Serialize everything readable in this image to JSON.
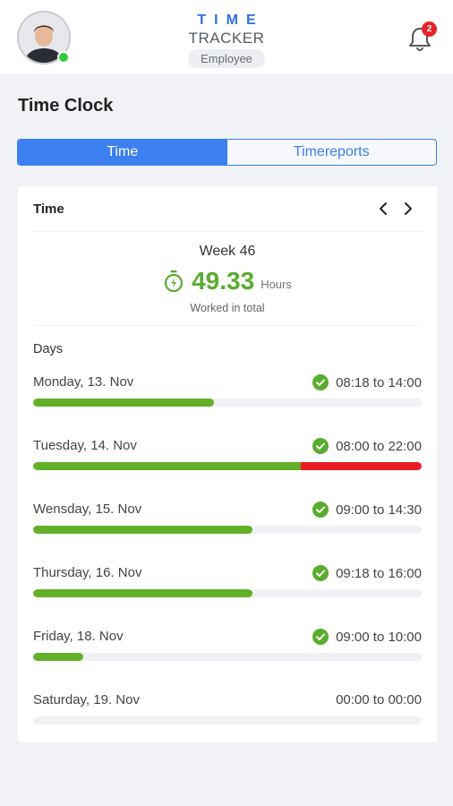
{
  "header": {
    "logo_line1": "TIME",
    "logo_line2": "TRACKER",
    "role": "Employee",
    "notification_count": "2",
    "user_status": "online"
  },
  "page": {
    "title": "Time Clock"
  },
  "tabs": [
    {
      "label": "Time",
      "active": true
    },
    {
      "label": "Timereports",
      "active": false
    }
  ],
  "card": {
    "title": "Time",
    "week_label": "Week 46",
    "total_hours": "49.33",
    "total_unit": "Hours",
    "total_caption": "Worked in total",
    "days_heading": "Days",
    "days": [
      {
        "name": "Monday, 13. Nov",
        "time": "08:18 to 14:00",
        "checked": true,
        "progress": 0.465,
        "overtime_from": null
      },
      {
        "name": "Tuesday, 14. Nov",
        "time": "08:00 to 22:00",
        "checked": true,
        "progress": 1.0,
        "overtime_from": 0.69
      },
      {
        "name": "Wensday, 15. Nov",
        "time": "09:00 to 14:30",
        "checked": true,
        "progress": 0.565,
        "overtime_from": null
      },
      {
        "name": "Thursday, 16. Nov",
        "time": "09:18 to 16:00",
        "checked": true,
        "progress": 0.565,
        "overtime_from": null
      },
      {
        "name": "Friday, 18. Nov",
        "time": "09:00 to 10:00",
        "checked": true,
        "progress": 0.13,
        "overtime_from": null
      },
      {
        "name": "Saturday, 19. Nov",
        "time": "00:00 to 00:00",
        "checked": false,
        "progress": 0,
        "overtime_from": null
      }
    ]
  },
  "colors": {
    "accent": "#3b7ff0",
    "worked": "#62b027",
    "overtime": "#ee1c25",
    "badge": "#e8232a"
  },
  "icons": {
    "bell": "bell-icon",
    "check": "check-circle-icon",
    "timer": "stopwatch-icon",
    "prev": "chevron-left-icon",
    "next": "chevron-right-icon"
  }
}
